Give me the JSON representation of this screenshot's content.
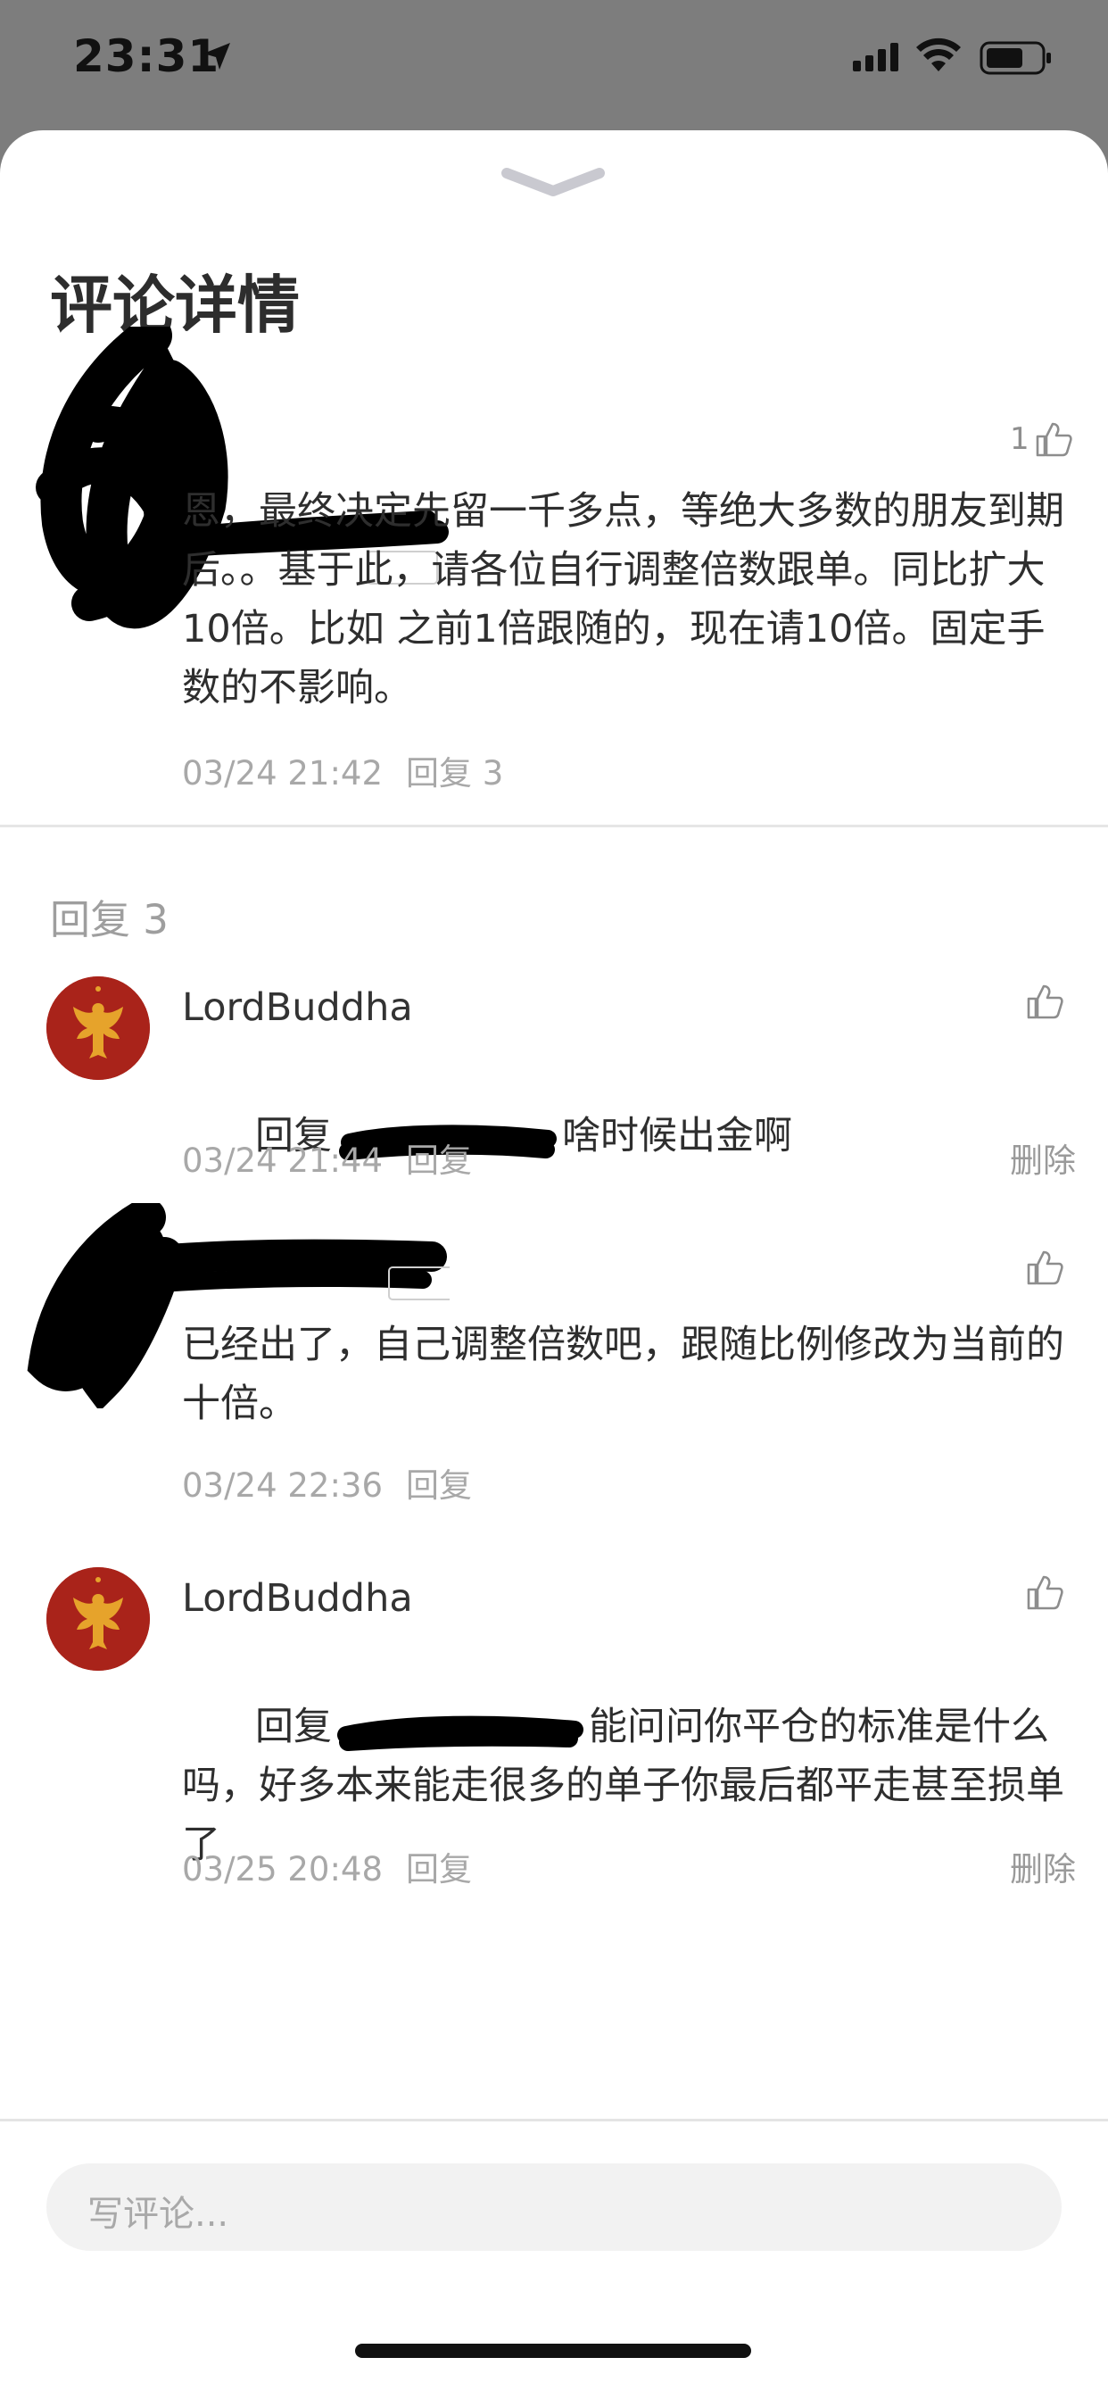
{
  "status_bar": {
    "time": "23:31"
  },
  "sheet": {
    "title": "评论详情"
  },
  "main_comment": {
    "like_count": "1",
    "text": "恩，最终决定先留一千多点，等绝大多数的朋友到期后。。基于此，请各位自行调整倍数跟单。同比扩大10倍。比如 之前1倍跟随的，现在请10倍。固定手数的不影响。",
    "date": "03/24 21:42",
    "reply_label": "回复 3"
  },
  "replies_section": {
    "label": "回复 3"
  },
  "replies": [
    {
      "username": "LordBuddha",
      "prefix": "回复",
      "text": "啥时候出金啊",
      "date": "03/24 21:44",
      "reply_label": "回复",
      "delete_label": "删除"
    },
    {
      "text": "已经出了，自己调整倍数吧，跟随比例修改为当前的十倍。",
      "date": "03/24 22:36",
      "reply_label": "回复"
    },
    {
      "username": "LordBuddha",
      "prefix": "回复",
      "text": "能问问你平仓的标准是什么吗，好多本来能走很多的单子你最后都平走甚至损单了",
      "date": "03/25 20:48",
      "reply_label": "回复",
      "delete_label": "删除"
    }
  ],
  "composer": {
    "placeholder": "写评论..."
  },
  "icons": {
    "thumb": "thumbs-up-icon",
    "location": "location-arrow-icon",
    "signal": "cellular-signal-icon",
    "wifi": "wifi-icon",
    "battery": "battery-icon",
    "handle": "chevron-down-handle-icon"
  }
}
